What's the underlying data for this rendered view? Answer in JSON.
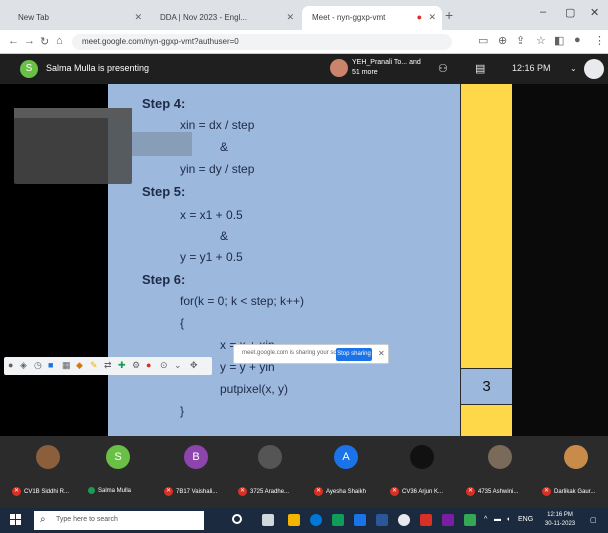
{
  "browser": {
    "tabs": [
      {
        "label": "New Tab"
      },
      {
        "label": "DDA | Nov 2023 - Engl..."
      },
      {
        "label": "Meet - nyn-ggxp-vmt"
      }
    ],
    "url": "meet.google.com/nyn-ggxp-vmt?authuser=0",
    "window_controls": [
      "–",
      "▢",
      "✕"
    ]
  },
  "meet": {
    "presenter_initial": "S",
    "presenting_text": "Salma Mulla is presenting",
    "participants_text": "YEH_Pranali To... and 51 more",
    "participant_count_icon": "people-icon",
    "time": "12:16 PM"
  },
  "slide": {
    "step4_title": "Step 4:",
    "xin_line": "xin = dx / step",
    "amp1": "&",
    "yin_line": "yin = dy / step",
    "step5_title": "Step 5:",
    "x_line": "x = x1 + 0.5",
    "amp2": "&",
    "y_line": "y = y1 + 0.5",
    "step6_title": "Step 6:",
    "for_line": "for(k = 0; k < step; k++)",
    "open_brace": "{",
    "x_inc": "x = x + xin",
    "y_inc": "y = y + yin",
    "putpixel": "putpixel(x, y)",
    "close_brace": "}",
    "page_number": "3"
  },
  "popup": {
    "text": "meet.google.com is sharing your screen",
    "button": "Stop sharing",
    "close": "✕"
  },
  "participants": [
    {
      "initial": "",
      "color": "#8b5e3c",
      "label": "CV1B Siddhi R..."
    },
    {
      "initial": "S",
      "color": "#6abf47",
      "label": "Salma Mulla"
    },
    {
      "initial": "B",
      "color": "#8e44ad",
      "label": "7B17 Vaishali..."
    },
    {
      "initial": "",
      "color": "#555555",
      "label": "3725 Aradhe..."
    },
    {
      "initial": "A",
      "color": "#1a73e8",
      "label": "Ayesha Shaikh"
    },
    {
      "initial": "",
      "color": "#111111",
      "label": "CV36 Arjun K..."
    },
    {
      "initial": "",
      "color": "#7a6a5a",
      "label": "4735 Ashwini..."
    },
    {
      "initial": "",
      "color": "#c98b4a",
      "label": "Darlikak Gaur..."
    }
  ],
  "taskbar": {
    "search_placeholder": "Type here to search",
    "time": "12:16 PM",
    "date": "30-11-2023",
    "lang": "ENG"
  }
}
